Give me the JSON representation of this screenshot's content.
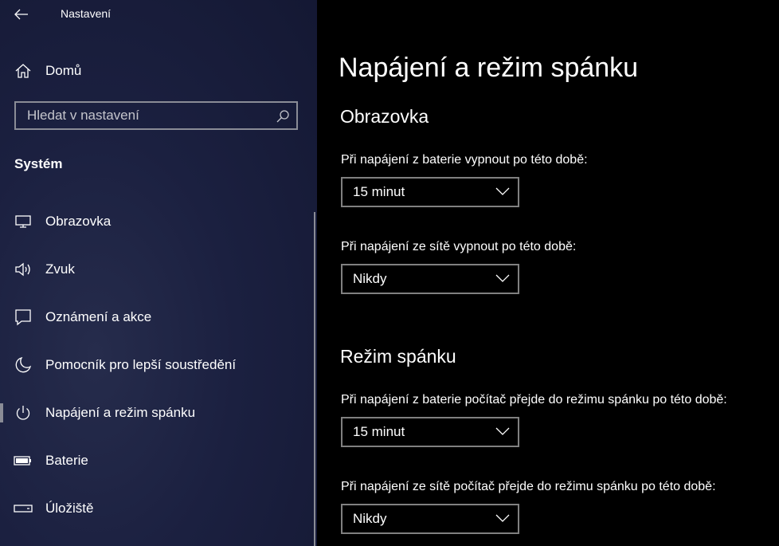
{
  "app": {
    "title": "Nastavení"
  },
  "sidebar": {
    "home_label": "Domů",
    "search_placeholder": "Hledat v nastavení",
    "section_label": "Systém",
    "items": [
      {
        "label": "Obrazovka",
        "icon": "monitor-icon"
      },
      {
        "label": "Zvuk",
        "icon": "speaker-icon"
      },
      {
        "label": "Oznámení a akce",
        "icon": "notification-icon"
      },
      {
        "label": "Pomocník pro lepší soustředění",
        "icon": "moon-icon"
      },
      {
        "label": "Napájení a režim spánku",
        "icon": "power-icon",
        "active": true
      },
      {
        "label": "Baterie",
        "icon": "battery-icon"
      },
      {
        "label": "Úložiště",
        "icon": "storage-icon"
      }
    ]
  },
  "main": {
    "title": "Napájení a režim spánku",
    "screen_section": {
      "title": "Obrazovka",
      "battery_label": "Při napájení z baterie vypnout po této době:",
      "battery_value": "15 minut",
      "ac_label": "Při napájení ze sítě vypnout po této době:",
      "ac_value": "Nikdy"
    },
    "sleep_section": {
      "title": "Režim spánku",
      "battery_label": "Při napájení z baterie počítač přejde do režimu spánku po této době:",
      "battery_value": "15 minut",
      "ac_label": "Při napájení ze sítě počítač přejde do režimu spánku po této době:",
      "ac_value": "Nikdy"
    }
  },
  "colors": {
    "sidebar_bg": "#1b2040",
    "main_bg": "#000000",
    "border": "#808080",
    "text": "#ffffff"
  }
}
